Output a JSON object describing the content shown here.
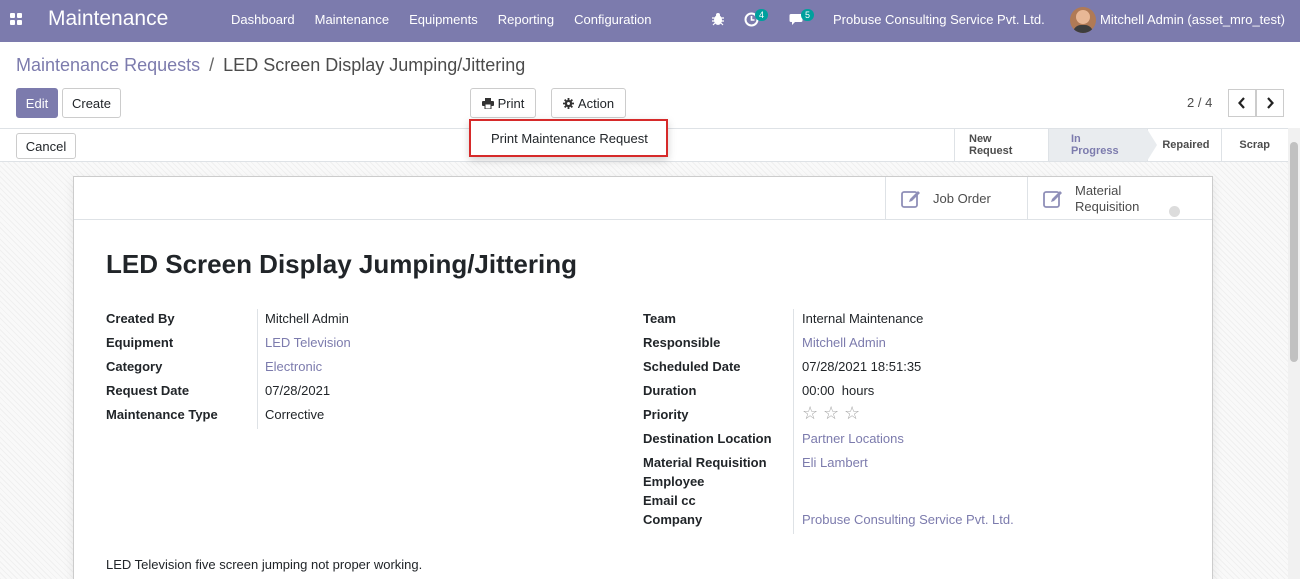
{
  "navbar": {
    "app_name": "Maintenance",
    "menu": [
      "Dashboard",
      "Maintenance",
      "Equipments",
      "Reporting",
      "Configuration"
    ],
    "activity_count": "4",
    "message_count": "5",
    "company": "Probuse Consulting Service Pvt. Ltd.",
    "user": "Mitchell Admin (asset_mro_test)"
  },
  "breadcrumb": {
    "parent": "Maintenance Requests",
    "separator": "/",
    "current": "LED Screen Display Jumping/Jittering"
  },
  "buttons": {
    "edit": "Edit",
    "create": "Create",
    "print": "Print",
    "action": "Action",
    "cancel": "Cancel"
  },
  "pager": {
    "value": "2 / 4"
  },
  "print_menu": {
    "item": "Print Maintenance Request"
  },
  "stages": [
    {
      "label": "New Request",
      "active": false
    },
    {
      "label": "In Progress",
      "active": true
    },
    {
      "label": "Repaired",
      "active": false
    },
    {
      "label": "Scrap",
      "active": false
    }
  ],
  "smart_buttons": {
    "job_order": "Job Order",
    "material_requisition_1": "Material",
    "material_requisition_2": "Requisition"
  },
  "record": {
    "title": "LED Screen Display Jumping/Jittering",
    "left": [
      {
        "label": "Created By",
        "value": "Mitchell Admin",
        "link": false
      },
      {
        "label": "Equipment",
        "value": "LED Television",
        "link": true
      },
      {
        "label": "Category",
        "value": "Electronic",
        "link": true
      },
      {
        "label": "Request Date",
        "value": "07/28/2021",
        "link": false
      },
      {
        "label": "Maintenance Type",
        "value": "Corrective",
        "link": false
      }
    ],
    "right": [
      {
        "label": "Team",
        "value": "Internal Maintenance",
        "link": false
      },
      {
        "label": "Responsible",
        "value": "Mitchell Admin",
        "link": true
      },
      {
        "label": "Scheduled Date",
        "value": "07/28/2021 18:51:35",
        "link": false
      },
      {
        "label": "Duration",
        "value": "00:00  hours",
        "link": false
      },
      {
        "label": "Priority",
        "value": "",
        "link": false
      },
      {
        "label": "Destination Location",
        "value": "Partner Locations",
        "link": true
      },
      {
        "label": "Material Requisition",
        "value": "Eli Lambert",
        "link": true
      },
      {
        "label": "Employee",
        "value": "",
        "link": false
      },
      {
        "label": "Email cc",
        "value": "",
        "link": false
      },
      {
        "label": "Company",
        "value": "Probuse Consulting Service Pvt. Ltd.",
        "link": true
      }
    ],
    "priority_stars": 3,
    "priority_selected": 0,
    "description": "LED Television five screen jumping not proper working."
  },
  "colors": {
    "brand": "#7c7bad",
    "badge": "#00a09d",
    "highlight": "#d62a2a"
  }
}
